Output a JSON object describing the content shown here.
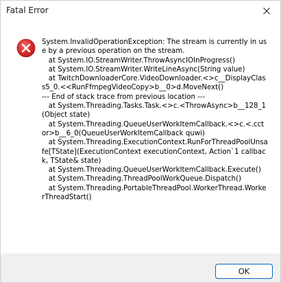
{
  "window": {
    "title": "Fatal Error"
  },
  "message": {
    "icon": "error-icon",
    "text": "System.InvalidOperationException: The stream is currently in use by a previous operation on the stream.\n   at System.IO.StreamWriter.ThrowAsyncIOInProgress()\n   at System.IO.StreamWriter.WriteLineAsync(String value)\n   at TwitchDownloaderCore.VideoDownloader.<>c__DisplayClass5_0.<<RunFfmpegVideoCopy>b__0>d.MoveNext()\n--- End of stack trace from previous location ---\n   at System.Threading.Tasks.Task.<>c.<ThrowAsync>b__128_1(Object state)\n   at System.Threading.QueueUserWorkItemCallback.<>c.<.cctor>b__6_0(QueueUserWorkItemCallback quwi)\n   at System.Threading.ExecutionContext.RunForThreadPoolUnsafe[TState](ExecutionContext executionContext, Action`1 callback, TState& state)\n   at System.Threading.QueueUserWorkItemCallback.Execute()\n   at System.Threading.ThreadPoolWorkQueue.Dispatch()\n   at System.Threading.PortableThreadPool.WorkerThread.WorkerThreadStart()"
  },
  "buttons": {
    "ok_label": "OK"
  },
  "colors": {
    "error_red": "#d92b2b",
    "button_border": "#0067c0",
    "footer_bg": "#f0f0f0"
  }
}
